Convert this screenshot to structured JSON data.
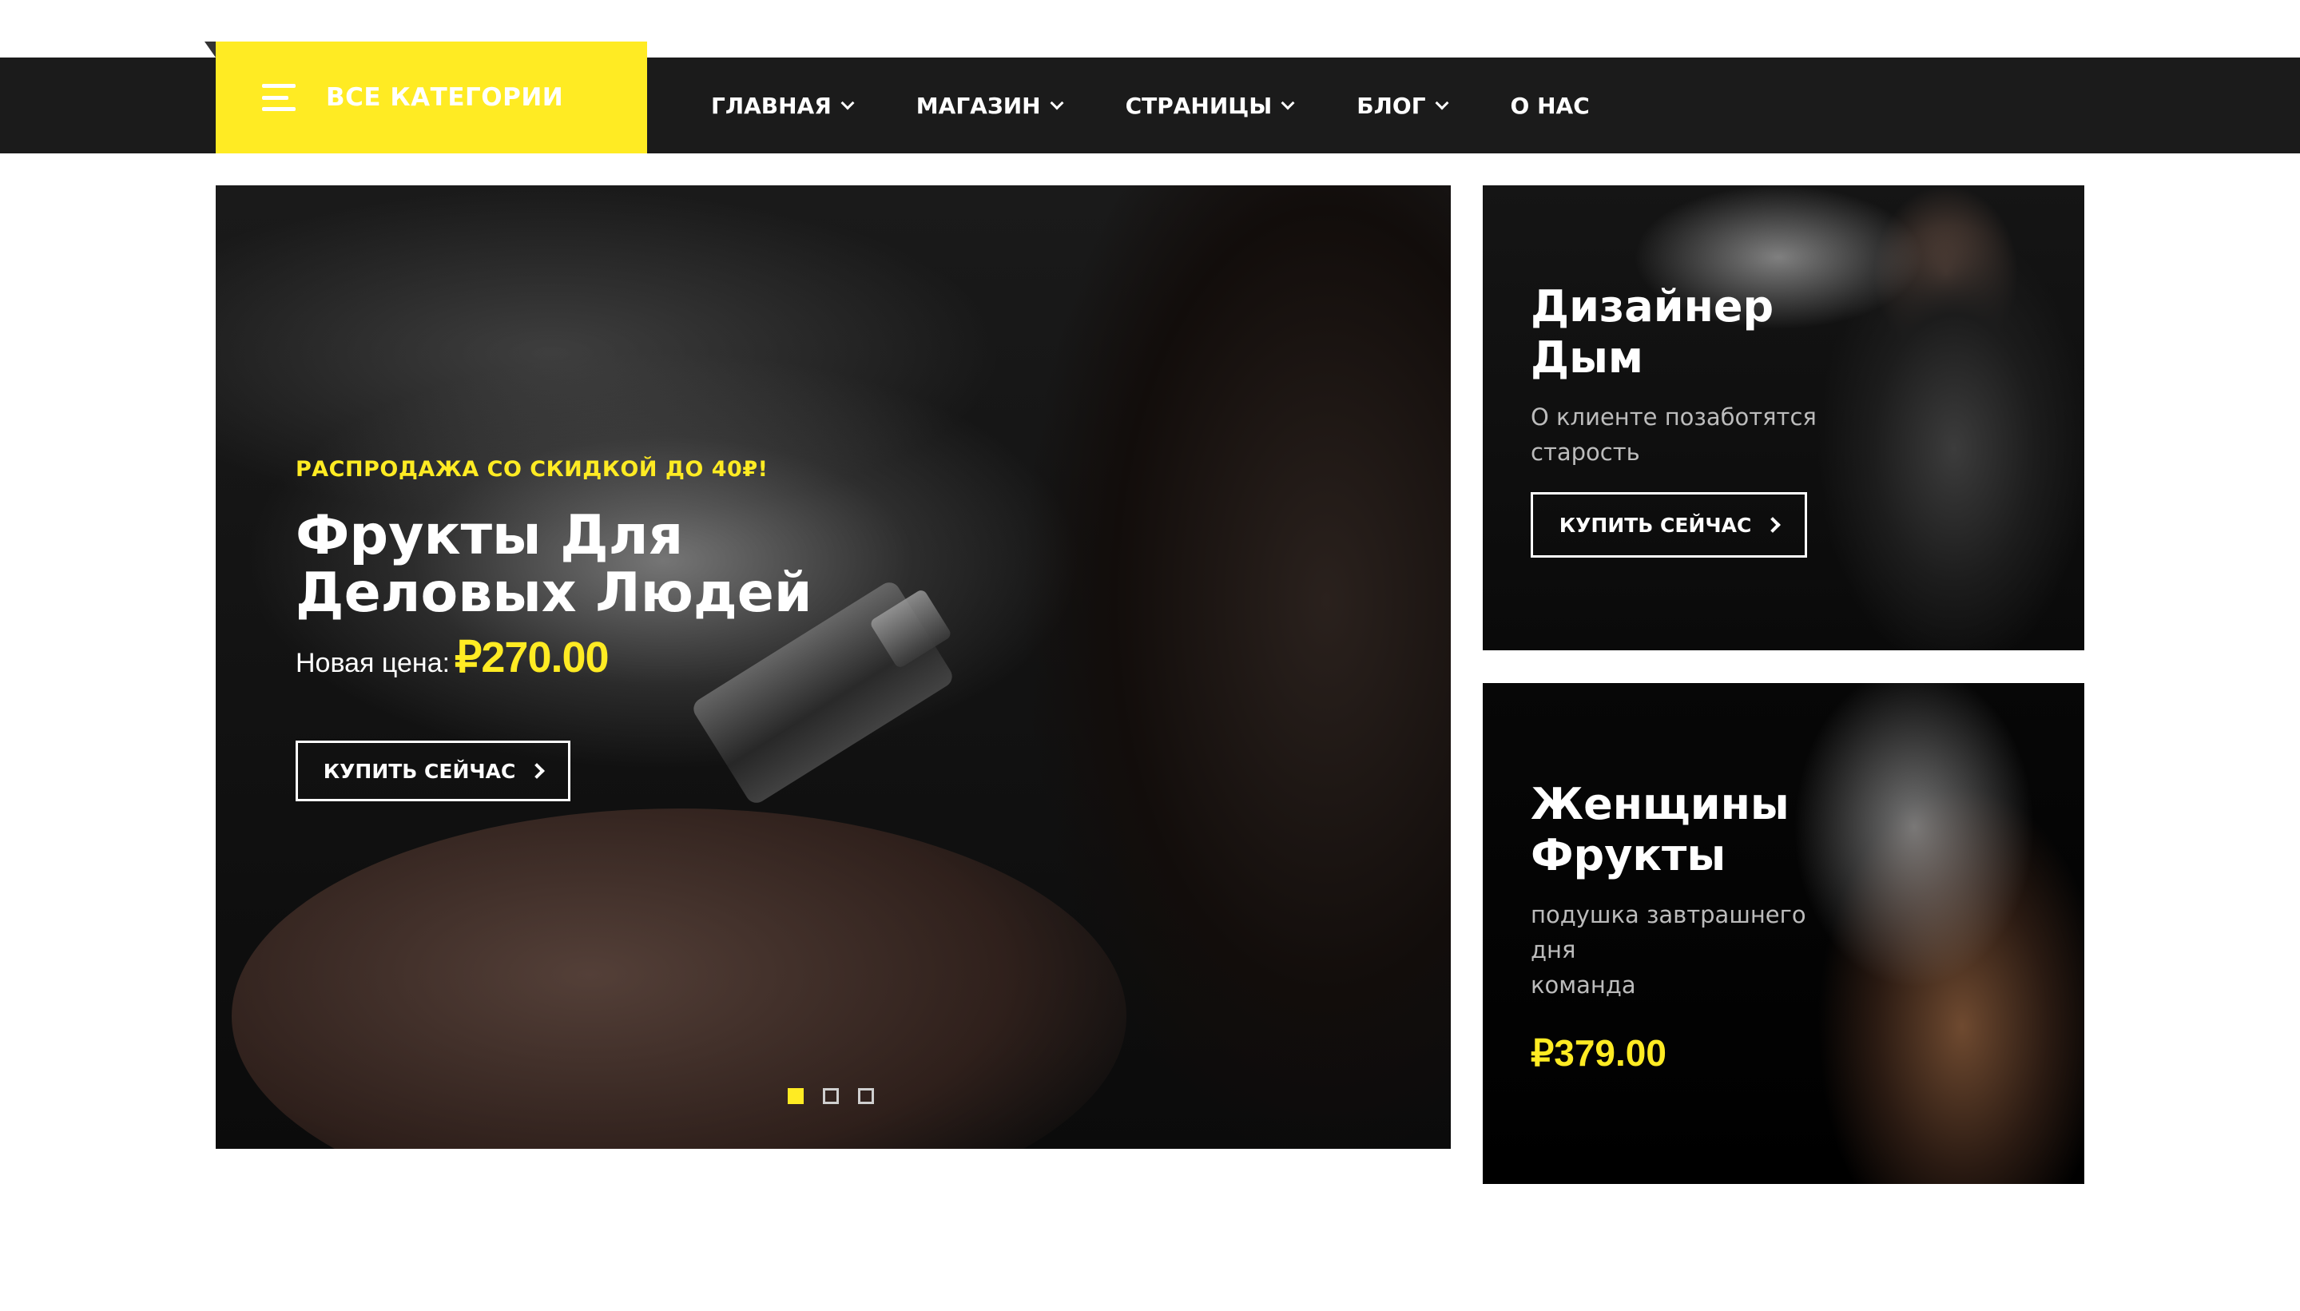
{
  "nav": {
    "categories_label": "ВСЕ КАТЕГОРИИ",
    "items": [
      {
        "label": "ГЛАВНАЯ",
        "dropdown": true
      },
      {
        "label": "МАГАЗИН",
        "dropdown": true
      },
      {
        "label": "СТРАНИЦЫ",
        "dropdown": true
      },
      {
        "label": "БЛОГ",
        "dropdown": true
      },
      {
        "label": "О НАС",
        "dropdown": false
      }
    ]
  },
  "hero": {
    "promo": "РАСПРОДАЖА СО СКИДКОЙ ДО 40₽!",
    "title": "Фрукты Для Деловых Людей",
    "price_label": "Новая цена:",
    "price_value": "₽270.00",
    "button_label": "КУПИТЬ СЕЙЧАС",
    "slides_total": 3,
    "active_slide": 1
  },
  "banners": [
    {
      "title": "Дизайнер Дым",
      "description": "О клиенте позаботятся старость",
      "button_label": "КУПИТЬ СЕЙЧАС"
    },
    {
      "title": "Женщины Фрукты",
      "description": "подушка завтрашнего\nдня\nкоманда",
      "price": "₽379.00"
    }
  ],
  "colors": {
    "accent": "#ffeb23",
    "navbar": "#1b1b1b",
    "text_light": "#ffffff"
  },
  "icons": [
    "hamburger-icon",
    "chevron-down-icon",
    "chevron-right-icon"
  ]
}
